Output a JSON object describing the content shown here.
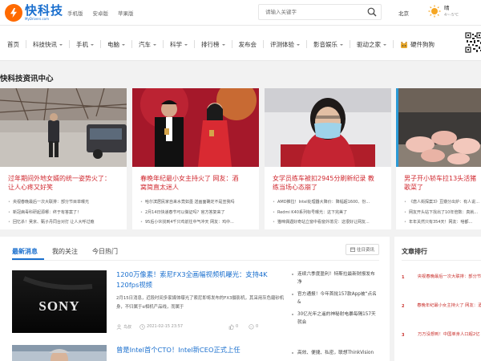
{
  "header": {
    "logo_name": "快科技",
    "logo_domain": "MyDrivers.com",
    "links": [
      "手机版",
      "安卓版",
      "苹果版"
    ],
    "search_placeholder": "请输入关键字",
    "city": "北京",
    "weather_condition": "晴",
    "weather_temp": "4~-5℃"
  },
  "nav": {
    "items": [
      {
        "label": "首页",
        "caret": false
      },
      {
        "label": "科技快讯",
        "caret": true
      },
      {
        "label": "手机",
        "caret": true
      },
      {
        "label": "电脑",
        "caret": true
      },
      {
        "label": "汽车",
        "caret": true
      },
      {
        "label": "科学",
        "caret": true
      },
      {
        "label": "排行榜",
        "caret": true
      },
      {
        "label": "发布会",
        "caret": false
      },
      {
        "label": "评测体验",
        "caret": true
      },
      {
        "label": "影音娱乐",
        "caret": true
      },
      {
        "label": "驱动之家",
        "caret": true
      },
      {
        "label": "硬件狗狗",
        "caret": false
      }
    ]
  },
  "section_title": "快科技资讯中心",
  "cards": [
    {
      "title_line1": "过年期间外地女婿的统一姿势火了：",
      "title_line2": "让人心疼又好笑",
      "items": [
        "央视春晚最后一次大联排：部分节目单曝光",
        "新冠病毒科研起源哪：终于有答案了！",
        "回忆杀！吴京、甄子丹同台对打 让人大呼过瘾"
      ]
    },
    {
      "title_line1": "春晚年纪最小女主持火了 网友：酒",
      "title_line2": "窝简直太迷人",
      "items": [
        "哈尔滨居民家自来水竟如墨 送画面确定不是宣我吗",
        "2月14日快递春节可以做证吗？官方答复来了",
        "95后小伙找到4千只鸡前往中气冲天 网友：鸡中..."
      ]
    },
    {
      "title_line1": "女学员练车被扣2945分刷新纪录 教",
      "title_line2": "练当场心态崩了",
      "items": [
        "AMD推拉！Intel处理器大降价：降幅超1600、份...",
        "Redmi K40系列标号曝光：这下完美了",
        "猫咪偶遇好奇站立窗中看窗外境况：这很好让网友..."
      ]
    },
    {
      "title_line1": "男子开小轿车拉13头活猪",
      "title_line2": "歌菜了",
      "items": [
        "《唐人街探案3》豆瓣分出炉：有人说...",
        "网友开头站下找出了10年倍数：真就...",
        "年年关然只有354天！网友：啥都..."
      ]
    }
  ],
  "tabs": [
    {
      "label": "最新消息",
      "active": true
    },
    {
      "label": "我的关注",
      "active": false
    },
    {
      "label": "今日热门",
      "active": false
    }
  ],
  "past_news": "往日资讯",
  "news": {
    "title": "1200万像素！索尼FX3全画幅视频机曝光：支持4K 120fps视频",
    "desc": "2月15日消息，近段时间多家媒体曝光了索尼即将发布的FX3摄影机，其采用灰色磨砂机身，不归属于α相机产品线，而属于",
    "author": "鸟叔",
    "time": "2021-02-15 23:57",
    "likes": "0",
    "comments": "0",
    "image_brand": "SONY"
  },
  "news2": {
    "title": "曾是Intel首个CTO！Intel新CEO正式上任"
  },
  "side_news": [
    "连续六季度盈利！特斯拉最新财报发布 净",
    "官方通报！今年首批157款App被“点名&",
    "30亿光年之遥的神秘射电暴每隔157天就会"
  ],
  "side_news2": "高效、便捷、私密，联想ThinkVision",
  "rank": {
    "title": "文章排行",
    "items": [
      {
        "num": "1",
        "text": "央视春晚最后一次大联排：部分节目单曝光"
      },
      {
        "num": "2",
        "text": "春晚年纪最小女主持火了 网友：酒窝简直太迷人"
      },
      {
        "num": "3",
        "text": "万万没想到！中国单身人口超2亿 年轻人"
      }
    ]
  },
  "colors": {
    "brand": "#1a6fce",
    "headline_red": "#d0282f",
    "logo_orange": "#ff6a00"
  }
}
